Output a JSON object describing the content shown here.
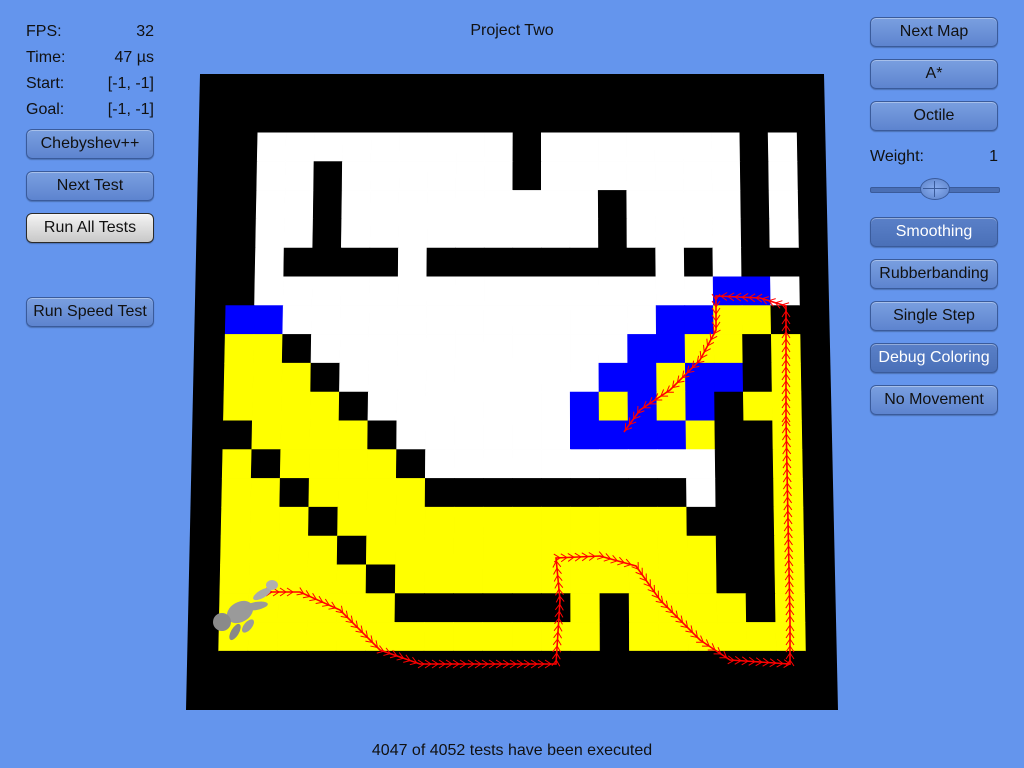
{
  "title": "Project Two",
  "stats": {
    "fps_label": "FPS:",
    "fps_value": "32",
    "time_label": "Time:",
    "time_value": "47 µs",
    "start_label": "Start:",
    "start_value": "[-1, -1]",
    "goal_label": "Goal:",
    "goal_value": "[-1, -1]"
  },
  "left_buttons": {
    "heuristic": "Chebyshev++",
    "next_test": "Next Test",
    "run_all": "Run All Tests",
    "speed_test": "Run Speed Test"
  },
  "right_buttons": {
    "next_map": "Next Map",
    "algorithm": "A*",
    "heuristic_mode": "Octile",
    "smoothing": "Smoothing",
    "rubberbanding": "Rubberbanding",
    "single_step": "Single Step",
    "debug_coloring": "Debug Coloring",
    "no_movement": "No Movement"
  },
  "weight": {
    "label": "Weight:",
    "value": "1",
    "slider_fraction": 0.5
  },
  "footer": "4047 of 4052 tests have been executed",
  "colors": {
    "background": "#6495ED",
    "wall": "#000000",
    "open": "#FFFFFF",
    "closed": "#FFFF00",
    "open_list": "#0000FF",
    "path": "#FF0000"
  },
  "map": {
    "rows": [
      "WWWWWWWWWWWWWWWWWWWW",
      "W.........W.......W.",
      "W..W......W.......W.",
      "W..W.........W....W.",
      "W..W.........W....W.",
      "W.WWWW.WWWWWWWW.W.WW",
      "W................BB.WB",
      "BB.............BBYYW",
      "YYW...........BBYYWY",
      "YYYW.........BBYBBWY",
      "YYYYW.......BYBYBWYY",
      "WYYYYW......BBBBYWWY",
      "YWYYYYW..........WWY",
      "YYWYYYYWWWWWWWWW.WWY",
      "YYYWYYYYYYYYYYYYWWWY",
      "YYYYWYYYYYYYYYYYYWWY",
      "YYYYYWYYYYYYYYYYYWWY",
      "YYYYYYWWWWWWYWYYYYWY",
      "YYYYYYYYYYYYYWYYYYYY",
      "WWWWWWWWWWWWWWWWWWWW"
    ]
  }
}
